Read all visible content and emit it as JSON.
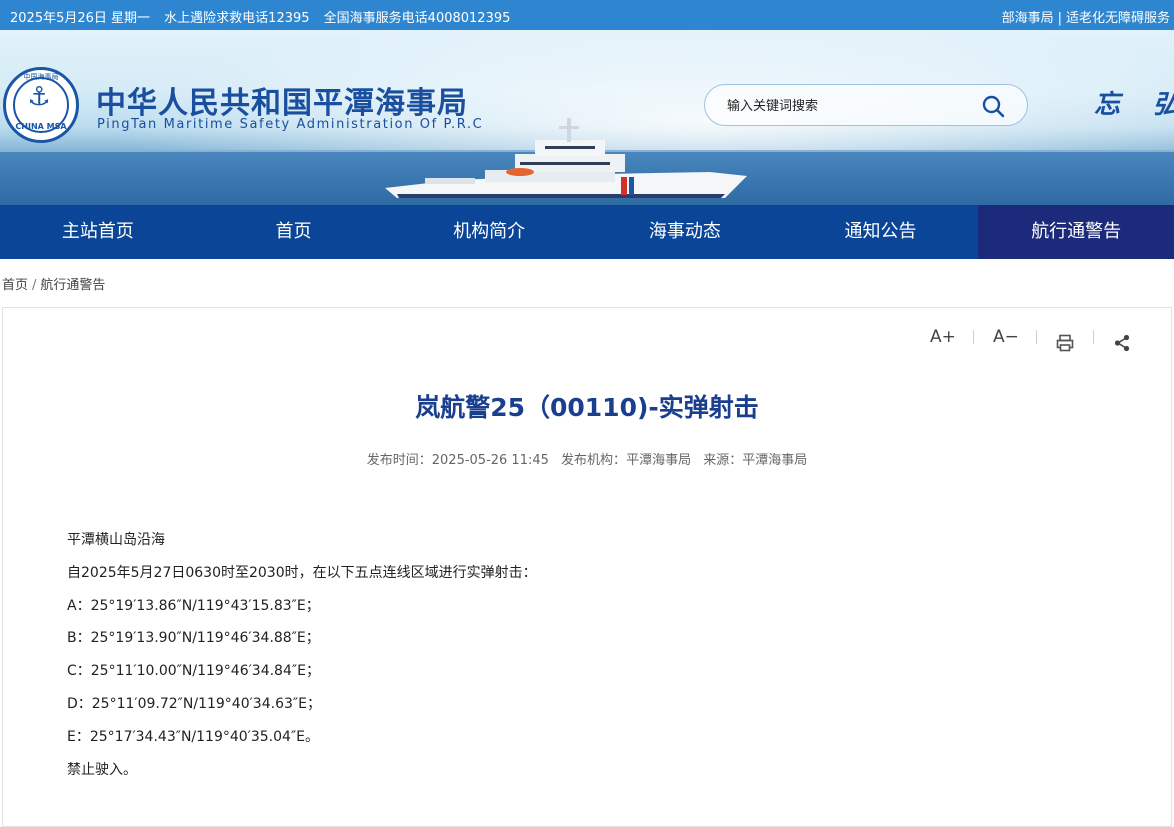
{
  "topbar": {
    "date": "2025年5月26日 星期一",
    "rescue_hotline": "水上遇险求救电话12395",
    "service_hotline": "全国海事服务电话4008012395",
    "link_ministry": "部海事局",
    "link_accessible": "适老化无障碍服务"
  },
  "logo": {
    "ring_top": "中国海事局",
    "ring_bottom": "CHINA MSA"
  },
  "site": {
    "title_cn": "中华人民共和国平潭海事局",
    "title_en": "PingTan Maritime Safety Administration Of P.R.C",
    "motto": "忘 弘"
  },
  "search": {
    "placeholder": "输入关键词搜索"
  },
  "nav": {
    "items": [
      "主站首页",
      "首页",
      "机构简介",
      "海事动态",
      "通知公告",
      "航行通警告"
    ]
  },
  "breadcrumb": {
    "home": "首页",
    "current": "航行通警告"
  },
  "tools": {
    "font_up": "A+",
    "font_down": "A−"
  },
  "article": {
    "title": "岚航警25（00110)-实弹射击",
    "publish_time_label": "发布时间：",
    "publish_time": "2025-05-26 11:45",
    "org_label": "发布机构：",
    "org": "平潭海事局",
    "source_label": "来源：",
    "source": "平潭海事局",
    "paragraphs": [
      "平潭横山岛沿海",
      "自2025年5月27日0630时至2030时，在以下五点连线区域进行实弹射击：",
      "A：25°19′13.86″N/119°43′15.83″E；",
      "B：25°19′13.90″N/119°46′34.88″E；",
      "C：25°11′10.00″N/119°46′34.84″E；",
      "D：25°11′09.72″N/119°40′34.63″E；",
      "E：25°17′34.43″N/119°40′35.04″E。",
      "禁止驶入。"
    ]
  },
  "colors": {
    "topbar": "#2e86d0",
    "nav_bg": "#0b4597",
    "nav_active": "#1b2a7a",
    "title_blue": "#1a3f8f"
  }
}
